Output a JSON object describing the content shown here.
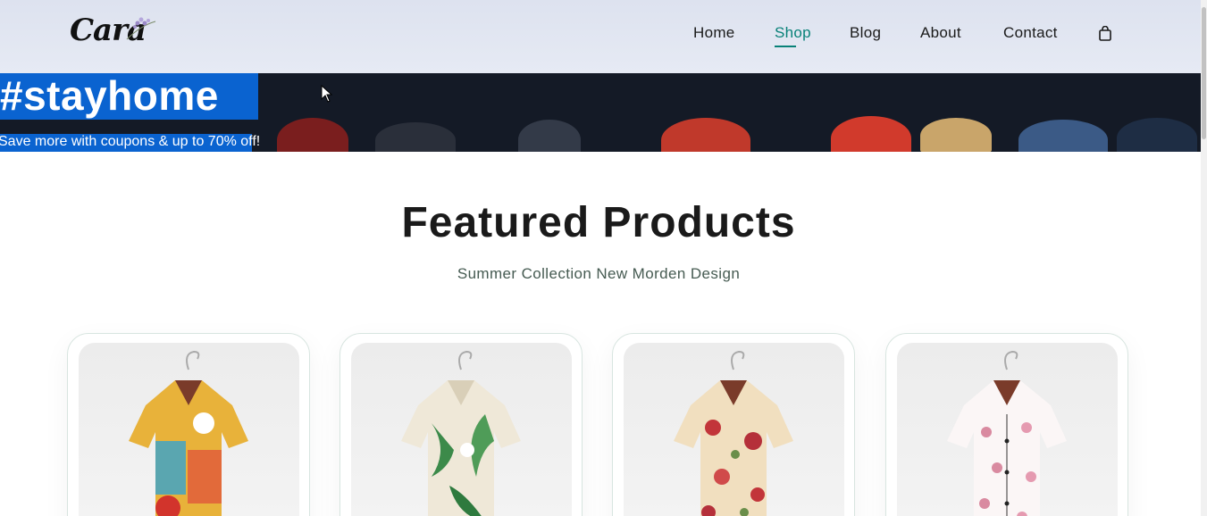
{
  "header": {
    "logo_text": "Cara",
    "nav": [
      {
        "label": "Home",
        "active": false
      },
      {
        "label": "Shop",
        "active": true
      },
      {
        "label": "Blog",
        "active": false
      },
      {
        "label": "About",
        "active": false
      },
      {
        "label": "Contact",
        "active": false
      }
    ],
    "cart_icon": "shopping-bag-icon"
  },
  "hero": {
    "title": "#stayhome",
    "subtitle": "Save more with coupons & up to 70% off!"
  },
  "featured": {
    "title": "Featured Products",
    "subtitle": "Summer Collection New Morden Design",
    "products": [
      {
        "image": "colorful-patchwork-shirt"
      },
      {
        "image": "green-leaf-floral-shirt"
      },
      {
        "image": "cream-red-rose-shirt"
      },
      {
        "image": "white-pink-blossom-shirt"
      }
    ]
  },
  "colors": {
    "accent": "#088178",
    "selection": "#0a63d0",
    "header_bg": "#e3e7f2",
    "hero_bg": "#141a26"
  }
}
